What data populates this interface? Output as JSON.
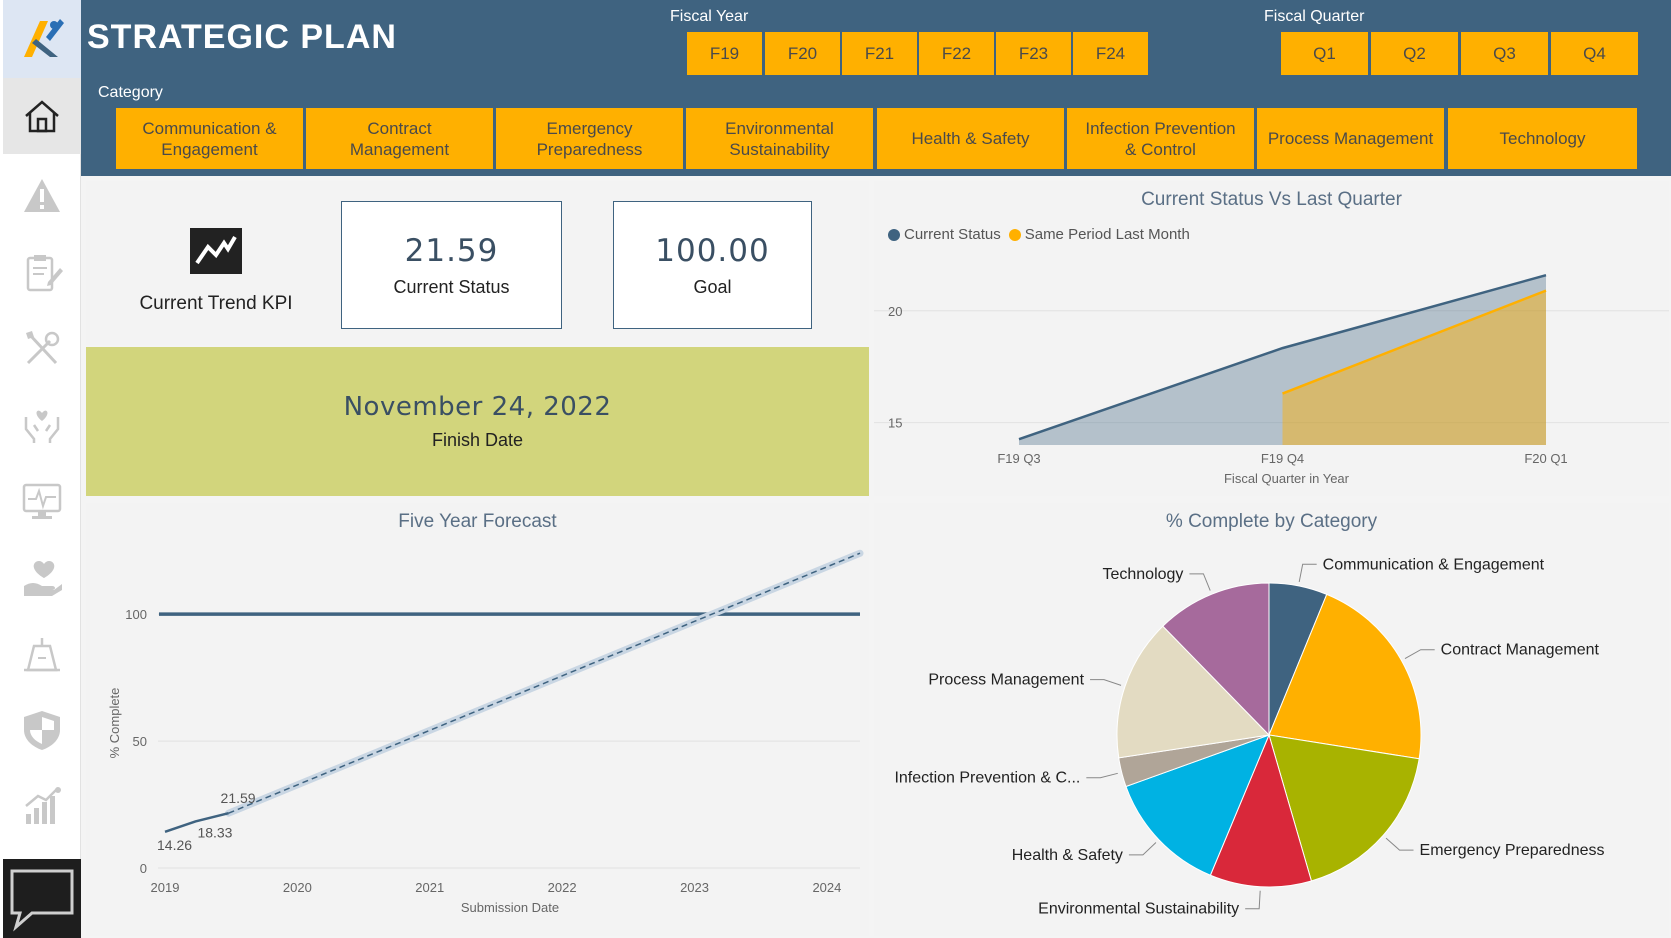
{
  "app": {
    "title": "STRATEGIC PLAN"
  },
  "sidebar": {
    "items": [
      {
        "icon": "home-icon"
      },
      {
        "icon": "warning-icon"
      },
      {
        "icon": "clipboard-icon"
      },
      {
        "icon": "tools-icon"
      },
      {
        "icon": "helping-hands-icon"
      },
      {
        "icon": "monitor-pulse-icon"
      },
      {
        "icon": "heart-hand-icon"
      },
      {
        "icon": "building-icon"
      },
      {
        "icon": "shield-icon"
      },
      {
        "icon": "growth-chart-icon"
      }
    ],
    "chat_icon": "chat-icon"
  },
  "filters": {
    "fiscal_year": {
      "label": "Fiscal Year",
      "options": [
        "F19",
        "F20",
        "F21",
        "F22",
        "F23",
        "F24"
      ]
    },
    "fiscal_quarter": {
      "label": "Fiscal Quarter",
      "options": [
        "Q1",
        "Q2",
        "Q3",
        "Q4"
      ]
    },
    "category": {
      "label": "Category",
      "options": [
        {
          "line1": "Communication &",
          "line2": "Engagement"
        },
        {
          "line1": "Contract",
          "line2": "Management"
        },
        {
          "line1": "Emergency",
          "line2": "Preparedness"
        },
        {
          "line1": "Environmental",
          "line2": "Sustainability"
        },
        {
          "line1": "Health & Safety",
          "line2": ""
        },
        {
          "line1": "Infection Prevention",
          "line2": "& Control"
        },
        {
          "line1": "Process Management",
          "line2": ""
        },
        {
          "line1": "Technology",
          "line2": ""
        }
      ]
    }
  },
  "kpis": {
    "trend_label": "Current Trend KPI",
    "current_status_value": "21.59",
    "current_status_label": "Current Status",
    "goal_value": "100.00",
    "goal_label": "Goal",
    "finish_date_value": "November 24, 2022",
    "finish_date_label": "Finish Date"
  },
  "colors": {
    "header": "#3f6380",
    "accent": "#ffb000",
    "finish_panel": "#d2d57c",
    "series_current": "#3f6380",
    "series_last": "#ffb000"
  },
  "chart_data": [
    {
      "type": "area",
      "title": "Current Status Vs Last Quarter",
      "xlabel": "Fiscal Quarter in Year",
      "ylabel": "",
      "categories": [
        "F19 Q3",
        "F19 Q4",
        "F20 Q1"
      ],
      "yticks": [
        15,
        20
      ],
      "ylim": [
        14,
        22
      ],
      "series": [
        {
          "name": "Current Status",
          "values": [
            14.26,
            18.33,
            21.59
          ],
          "color": "#3f6380"
        },
        {
          "name": "Same Period Last Month",
          "values": [
            null,
            16.3,
            20.9
          ],
          "color": "#ffb000"
        }
      ],
      "legend": "top-left",
      "grid": true
    },
    {
      "type": "line",
      "title": "Five Year Forecast",
      "xlabel": "Submission Date",
      "ylabel": "% Complete",
      "xticks": [
        "2019",
        "2020",
        "2021",
        "2022",
        "2023",
        "2024"
      ],
      "xlim": [
        2019,
        2024.25
      ],
      "yticks": [
        0,
        50,
        100
      ],
      "ylim": [
        0,
        130
      ],
      "goal": 100,
      "actual": {
        "x": [
          2019.0,
          2019.23,
          2019.48
        ],
        "values": [
          14.26,
          18.33,
          21.59
        ],
        "labels": [
          "14.26",
          "18.33",
          "21.59"
        ]
      },
      "forecast": {
        "x": [
          2019.48,
          2024.25
        ],
        "values": [
          21.59,
          124
        ]
      },
      "grid": true
    },
    {
      "type": "pie",
      "title": "% Complete by Category",
      "slices": [
        {
          "label": "Communication & Engagement",
          "value": 6.2,
          "color": "#3f6380"
        },
        {
          "label": "Contract Management",
          "value": 21.3,
          "color": "#ffb000"
        },
        {
          "label": "Emergency Preparedness",
          "value": 18.0,
          "color": "#a8b300"
        },
        {
          "label": "Environmental Sustainability",
          "value": 10.8,
          "color": "#d9283a"
        },
        {
          "label": "Health & Safety",
          "value": 13.2,
          "color": "#00b2e3"
        },
        {
          "label": "Infection Prevention & C...",
          "value": 3.1,
          "color": "#b0a598"
        },
        {
          "label": "Process Management",
          "value": 15.1,
          "color": "#e3dbc2"
        },
        {
          "label": "Technology",
          "value": 12.3,
          "color": "#a66a9c"
        }
      ]
    }
  ]
}
